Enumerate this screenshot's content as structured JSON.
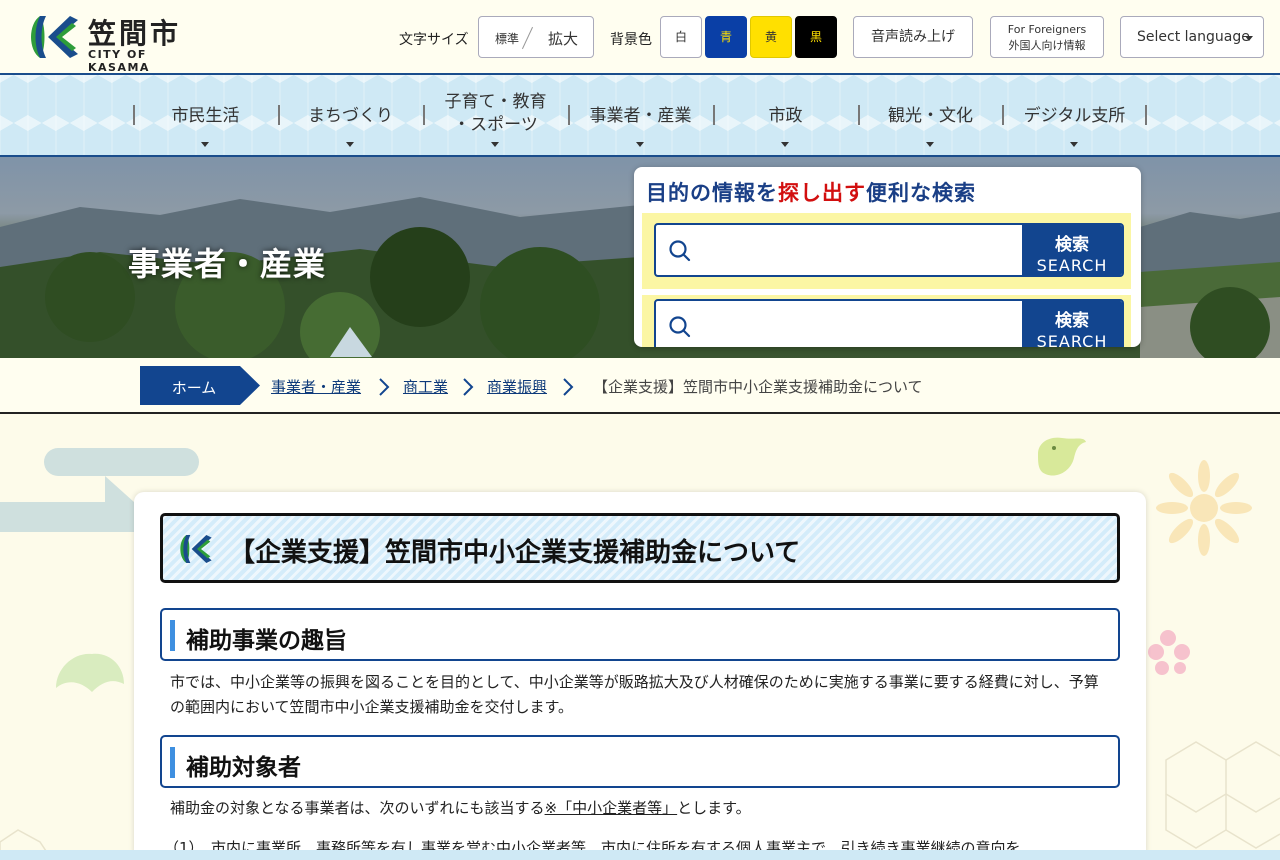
{
  "header": {
    "logo_name": "笠間市",
    "logo_sub": "CITY OF KASAMA",
    "font_size_label": "文字サイズ",
    "font_standard": "標準",
    "font_large": "拡大",
    "bg_label": "背景色",
    "bg_white": "白",
    "bg_blue": "青",
    "bg_yellow": "黄",
    "bg_black": "黒",
    "read_aloud": "音声読み上げ",
    "foreigners_en": "For Foreigners",
    "foreigners_jp": "外国人向け情報",
    "select_language": "Select language"
  },
  "nav": {
    "items": [
      {
        "label": "市民生活"
      },
      {
        "label": "まちづくり"
      },
      {
        "label1": "子育て・教育",
        "label2": "・スポーツ"
      },
      {
        "label": "事業者・産業"
      },
      {
        "label": "市政"
      },
      {
        "label": "観光・文化"
      },
      {
        "label": "デジタル支所"
      }
    ]
  },
  "hero": {
    "title": "事業者・産業"
  },
  "search": {
    "heading_pre": "目的の情報を",
    "heading_highlight": "探し出す",
    "heading_post": "便利な検索",
    "button_jp": "検索",
    "button_en": "SEARCH"
  },
  "breadcrumb": {
    "home": "ホーム",
    "links": [
      "事業者・産業",
      "商工業",
      "商業振興"
    ],
    "current": "【企業支援】笠間市中小企業支援補助金について"
  },
  "main": {
    "page_title": "【企業支援】笠間市中小企業支援補助金について",
    "sections": [
      {
        "heading": "補助事業の趣旨",
        "text": "市では、中小企業等の振興を図ることを目的として、中小企業等が販路拡大及び人材確保のために実施する事業に要する経費に対し、予算の範囲内において笠間市中小企業支援補助金を交付します。"
      },
      {
        "heading": "補助対象者",
        "text_pre": "補助金の対象となる事業者は、次のいずれにも該当する",
        "text_link": "※「中小企業者等」",
        "text_post": "とします。"
      }
    ],
    "list_item_1": "（1）　市内に事業所、事務所等を有し事業を営む中小企業者等、市内に住所を有する個人事業主で、引き続き事業継続の意向を"
  },
  "colors": {
    "brand_navy": "#12458f",
    "accent_red": "#d20f0f",
    "search_yellow": "#fbf6a4",
    "nav_bg": "#cfe9f5"
  }
}
